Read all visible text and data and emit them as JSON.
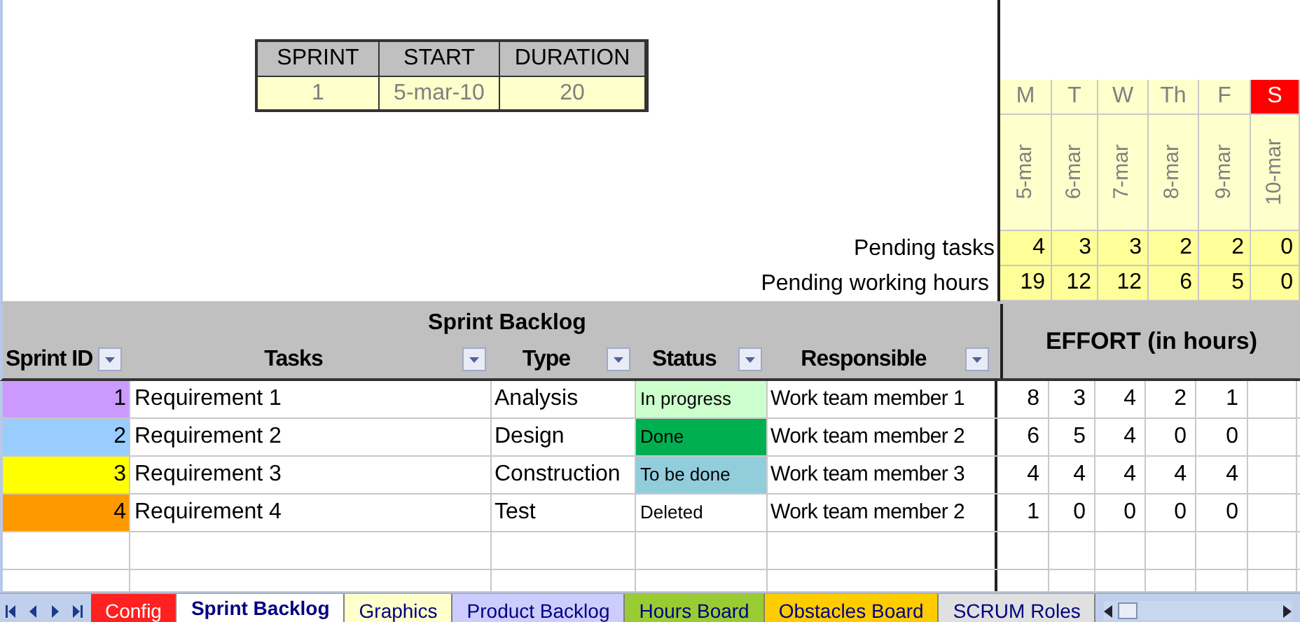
{
  "sprint_info": {
    "columns": [
      "SPRINT",
      "START",
      "DURATION"
    ],
    "values": [
      "1",
      "5-mar-10",
      "20"
    ]
  },
  "calendar": {
    "pending_tasks_label": "Pending tasks",
    "pending_hours_label": "Pending working hours",
    "days": [
      {
        "day": "M",
        "date": "5-mar",
        "weekend": false,
        "pending_tasks": "4",
        "pending_hours": "19"
      },
      {
        "day": "T",
        "date": "6-mar",
        "weekend": false,
        "pending_tasks": "3",
        "pending_hours": "12"
      },
      {
        "day": "W",
        "date": "7-mar",
        "weekend": false,
        "pending_tasks": "3",
        "pending_hours": "12"
      },
      {
        "day": "Th",
        "date": "8-mar",
        "weekend": false,
        "pending_tasks": "2",
        "pending_hours": "6"
      },
      {
        "day": "F",
        "date": "9-mar",
        "weekend": false,
        "pending_tasks": "2",
        "pending_hours": "5"
      },
      {
        "day": "S",
        "date": "10-mar",
        "weekend": true,
        "pending_tasks": "0",
        "pending_hours": "0"
      }
    ]
  },
  "backlog": {
    "title": "Sprint Backlog",
    "effort_title": "EFFORT (in hours)",
    "columns": [
      "Sprint ID",
      "Tasks",
      "Type",
      "Status",
      "Responsible"
    ],
    "rows": [
      {
        "id": "1",
        "color": "#cc99ff",
        "task": "Requirement 1",
        "type": "Analysis",
        "status": {
          "label": "In progress",
          "color": "#ccffcc"
        },
        "responsible": "Work team member 1",
        "effort": [
          "8",
          "3",
          "4",
          "2",
          "1"
        ]
      },
      {
        "id": "2",
        "color": "#99ccff",
        "task": "Requirement 2",
        "type": "Design",
        "status": {
          "label": "Done",
          "color": "#00b050"
        },
        "responsible": "Work team member 2",
        "effort": [
          "6",
          "5",
          "4",
          "0",
          "0"
        ]
      },
      {
        "id": "3",
        "color": "#ffff00",
        "task": "Requirement 3",
        "type": "Construction",
        "status": {
          "label": "To be done",
          "color": "#92cddc"
        },
        "responsible": "Work team member 3",
        "effort": [
          "4",
          "4",
          "4",
          "4",
          "4"
        ]
      },
      {
        "id": "4",
        "color": "#ff9900",
        "task": "Requirement 4",
        "type": "Test",
        "status": {
          "label": "Deleted",
          "color": "#ffffff"
        },
        "responsible": "Work team member 2",
        "effort": [
          "1",
          "0",
          "0",
          "0",
          "0"
        ]
      }
    ]
  },
  "sheet_tabs": [
    {
      "label": "Config",
      "color": "#ff2020",
      "selected": false
    },
    {
      "label": "Sprint Backlog",
      "color": "#ffffff",
      "selected": true
    },
    {
      "label": "Graphics",
      "color": "#ffffcc",
      "selected": false
    },
    {
      "label": "Product Backlog",
      "color": "#ccccff",
      "selected": false
    },
    {
      "label": "Hours Board",
      "color": "#99cc33",
      "selected": false
    },
    {
      "label": "Obstacles Board",
      "color": "#ffcc00",
      "selected": false
    },
    {
      "label": "SCRUM Roles",
      "color": "#e0e0e0",
      "selected": false
    }
  ]
}
